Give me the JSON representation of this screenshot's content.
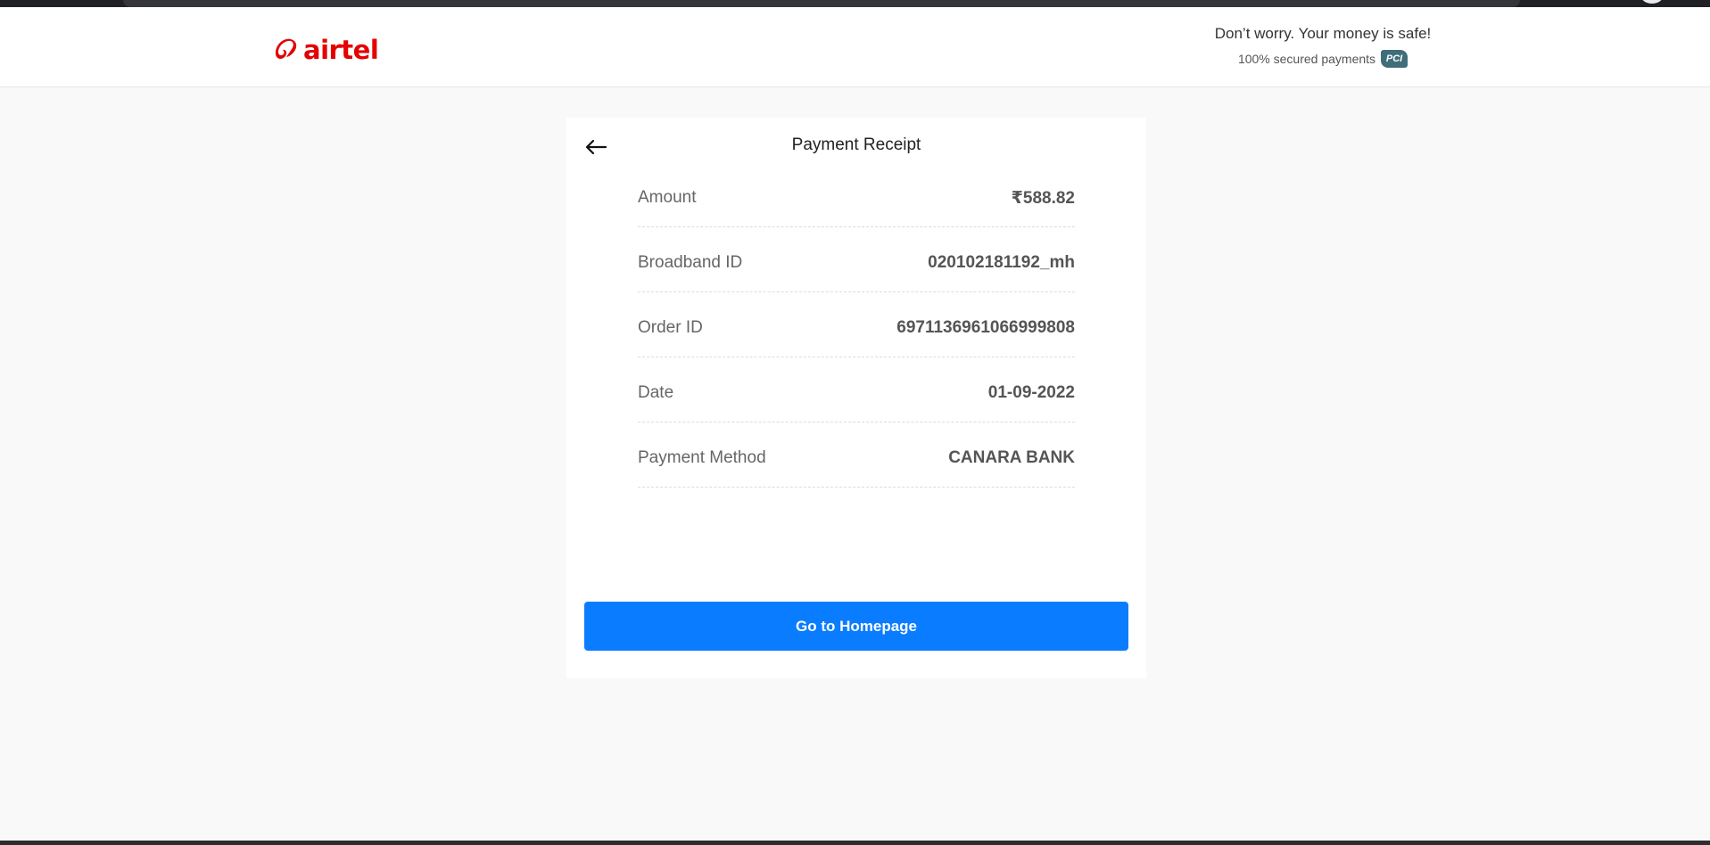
{
  "header": {
    "logo_text": "airtel",
    "safe_title": "Don’t worry. Your money is safe!",
    "safe_sub": "100% secured payments",
    "pci_badge": "PCI"
  },
  "receipt": {
    "title": "Payment Receipt",
    "rows": [
      {
        "label": "Amount",
        "value": "₹588.82"
      },
      {
        "label": "Broadband ID",
        "value": "020102181192_mh"
      },
      {
        "label": "Order ID",
        "value": "6971136961066999808"
      },
      {
        "label": "Date",
        "value": "01-09-2022"
      },
      {
        "label": "Payment Method",
        "value": "CANARA BANK"
      }
    ],
    "button_label": "Go to Homepage"
  },
  "colors": {
    "brand": "#e40000",
    "primary_button": "#0a7cff",
    "page_bg": "#f9f9f9"
  }
}
